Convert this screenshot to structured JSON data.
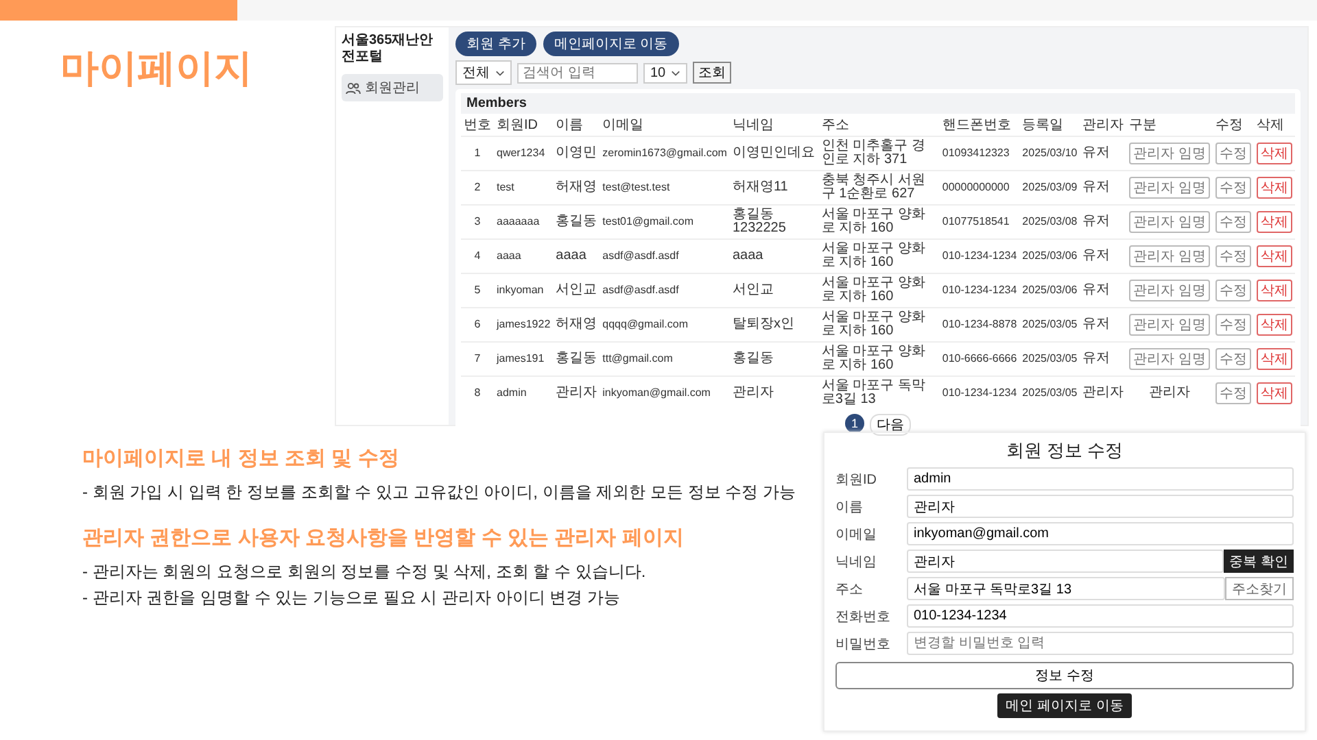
{
  "slide_title": "마이페이지",
  "app": {
    "brand": "서울365재난안전포털",
    "sidebar_items": [
      {
        "label": "회원관리",
        "selected": true
      }
    ],
    "header_buttons": [
      "회원 추가",
      "메인페이지로 이동"
    ],
    "toolbar": {
      "filter": "전체",
      "search_placeholder": "검색어 입력",
      "page_size": "10",
      "search_button": "조회"
    },
    "table": {
      "title": "Members",
      "columns": [
        "번호",
        "회원ID",
        "이름",
        "이메일",
        "닉네임",
        "주소",
        "핸드폰번호",
        "등록일",
        "관리자",
        "구분",
        "수정",
        "삭제"
      ],
      "rows": [
        {
          "cells": [
            "1",
            "qwer1234",
            "이영민",
            "zeromin1673@gmail.com",
            "이영민인데요",
            "인천 미추홀구 경인로 지하 371",
            "01093412323",
            "2025/03/10",
            "유저"
          ],
          "role": {
            "kind": "button",
            "label": "관리자 임명"
          },
          "edit": "수정",
          "delete": "삭제"
        },
        {
          "cells": [
            "2",
            "test",
            "허재영",
            "test@test.test",
            "허재영11",
            "충북 청주시 서원구 1순환로 627",
            "00000000000",
            "2025/03/09",
            "유저"
          ],
          "role": {
            "kind": "button",
            "label": "관리자 임명"
          },
          "edit": "수정",
          "delete": "삭제"
        },
        {
          "cells": [
            "3",
            "aaaaaaa",
            "홍길동",
            "test01@gmail.com",
            "홍길동1232225",
            "서울 마포구 양화로 지하 160",
            "01077518541",
            "2025/03/08",
            "유저"
          ],
          "role": {
            "kind": "button",
            "label": "관리자 임명"
          },
          "edit": "수정",
          "delete": "삭제"
        },
        {
          "cells": [
            "4",
            "aaaa",
            "aaaa",
            "asdf@asdf.asdf",
            "aaaa",
            "서울 마포구 양화로 지하 160",
            "010-1234-1234",
            "2025/03/06",
            "유저"
          ],
          "role": {
            "kind": "button",
            "label": "관리자 임명"
          },
          "edit": "수정",
          "delete": "삭제"
        },
        {
          "cells": [
            "5",
            "inkyoman",
            "서인교",
            "asdf@asdf.asdf",
            "서인교",
            "서울 마포구 양화로 지하 160",
            "010-1234-1234",
            "2025/03/06",
            "유저"
          ],
          "role": {
            "kind": "button",
            "label": "관리자 임명"
          },
          "edit": "수정",
          "delete": "삭제"
        },
        {
          "cells": [
            "6",
            "james1922",
            "허재영",
            "qqqq@gmail.com",
            "탈퇴장x인",
            "서울 마포구 양화로 지하 160",
            "010-1234-8878",
            "2025/03/05",
            "유저"
          ],
          "role": {
            "kind": "button",
            "label": "관리자 임명"
          },
          "edit": "수정",
          "delete": "삭제"
        },
        {
          "cells": [
            "7",
            "james191",
            "홍길동",
            "ttt@gmail.com",
            "홍길동",
            "서울 마포구 양화로 지하 160",
            "010-6666-6666",
            "2025/03/05",
            "유저"
          ],
          "role": {
            "kind": "button",
            "label": "관리자 임명"
          },
          "edit": "수정",
          "delete": "삭제"
        },
        {
          "cells": [
            "8",
            "admin",
            "관리자",
            "inkyoman@gmail.com",
            "관리자",
            "서울 마포구 독막로3길 13",
            "010-1234-1234",
            "2025/03/05",
            "관리자"
          ],
          "role": {
            "kind": "text",
            "label": "관리자"
          },
          "edit": "수정",
          "delete": "삭제"
        }
      ]
    },
    "pagination": {
      "pages": [
        {
          "label": "1",
          "selected": true
        }
      ],
      "next": "다음"
    }
  },
  "edit_form": {
    "title": "회원 정보 수정",
    "fields": [
      {
        "label": "회원ID",
        "value": "admin"
      },
      {
        "label": "이름",
        "value": "관리자"
      },
      {
        "label": "이메일",
        "value": "inkyoman@gmail.com"
      },
      {
        "label": "닉네임",
        "value": "관리자",
        "button": {
          "kind": "dark",
          "label": "중복 확인"
        }
      },
      {
        "label": "주소",
        "value": "서울 마포구 독막로3길 13",
        "button": {
          "kind": "outline",
          "label": "주소찾기"
        }
      },
      {
        "label": "전화번호",
        "value": "010-1234-1234"
      },
      {
        "label": "비밀번호",
        "placeholder": "변경할 비밀번호 입력"
      }
    ],
    "submit": "정보 수정",
    "home_button": "메인 페이지로 이동"
  },
  "sections": [
    {
      "heading": "마이페이지로 내 정보 조회 및 수정",
      "bullets": [
        "- 회원 가입 시 입력 한 정보를 조회할 수 있고 고유값인 아이디, 이름을 제외한 모든 정보 수정 가능"
      ]
    },
    {
      "heading": "관리자 권한으로 사용자 요청사항을 반영할 수 있는 관리자 페이지",
      "bullets": [
        "- 관리자는 회원의 요청으로 회원의 정보를 수정 및 삭제, 조회 할 수 있습니다.",
        "- 관리자 권한을 임명할 수 있는 기능으로 필요 시 관리자 아이디 변경 가능"
      ]
    }
  ]
}
